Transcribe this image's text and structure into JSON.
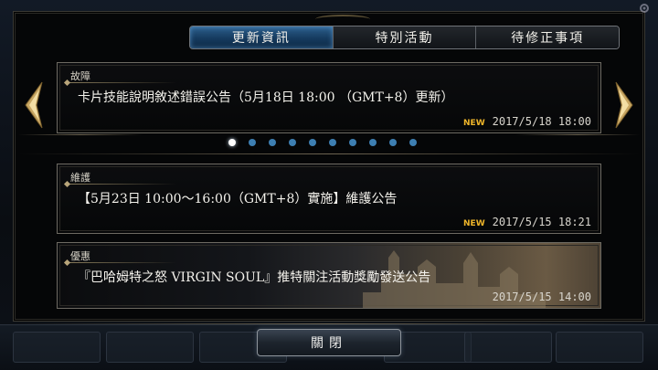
{
  "tabs": [
    {
      "label": "更新資訊",
      "active": true
    },
    {
      "label": "特別活動",
      "active": false
    },
    {
      "label": "待修正事項",
      "active": false
    }
  ],
  "featured": {
    "category": "故障",
    "title": "卡片技能說明敘述錯誤公告（5月18日 18:00 （GMT+8）更新）",
    "badge": "NEW",
    "date": "2017/5/18  18:00"
  },
  "carousel": {
    "page_count": 10,
    "active_index": 0
  },
  "news": [
    {
      "category": "維護",
      "title": "【5月23日 10:00〜16:00（GMT+8）實施】維護公告",
      "badge": "NEW",
      "date": "2017/5/15  18:21"
    },
    {
      "category": "優惠",
      "title": "『巴哈姆特之怒 VIRGIN SOUL』推特關注活動獎勵發送公告",
      "badge": "",
      "date": "2017/5/15  14:00"
    }
  ],
  "close_label": "關閉",
  "icons": {
    "prev": "chevron-left-icon",
    "next": "chevron-right-icon"
  },
  "colors": {
    "active_tab": "#1d4a72",
    "new_badge": "#f0b62a",
    "dot": "#3d7fb2",
    "frame": "#6d6a62"
  }
}
